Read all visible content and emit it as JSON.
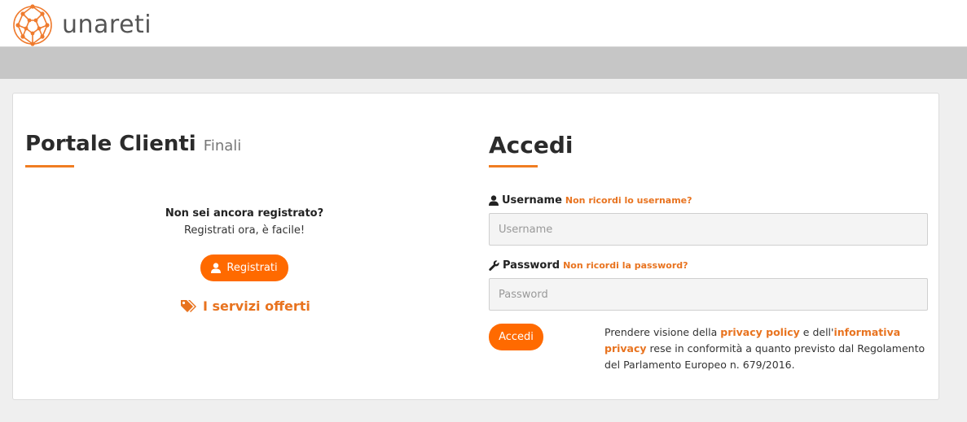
{
  "header": {
    "brand": "unareti",
    "logo_icon": "network-globe-icon"
  },
  "colors": {
    "accent": "#ff6a00",
    "accent_text": "#e8731f",
    "background": "#efefef",
    "greybar": "#c6c6c6"
  },
  "left": {
    "title": "Portale Clienti",
    "subtitle": "Finali",
    "question": "Non sei ancora registrato?",
    "subtext": "Registrati ora, è facile!",
    "register_button": "Registrati",
    "register_icon": "user-icon",
    "services_link": "I servizi offerti",
    "services_icon": "tags-icon"
  },
  "right": {
    "title": "Accedi",
    "username": {
      "icon": "user-icon",
      "label": "Username",
      "forgot": "Non ricordi lo username?",
      "placeholder": "Username"
    },
    "password": {
      "icon": "wrench-icon",
      "label": "Password",
      "forgot": "Non ricordi la password?",
      "placeholder": "Password"
    },
    "login_button": "Accedi",
    "privacy": {
      "text1": "Prendere visione della ",
      "link1": "privacy policy",
      "text2": " e dell'",
      "link2": "informativa privacy",
      "text3": " rese in conformità a quanto previsto dal Regolamento del Parlamento Europeo n. 679/2016."
    }
  }
}
